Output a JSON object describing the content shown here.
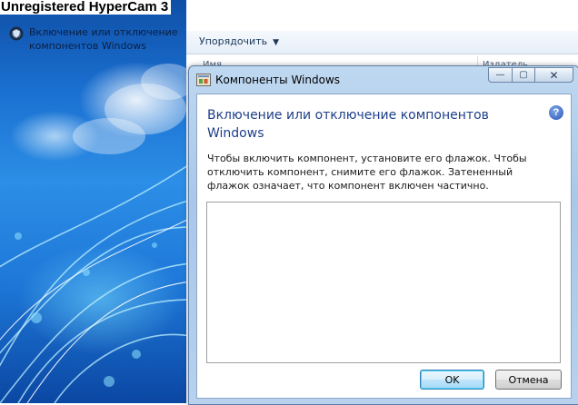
{
  "watermark": "Unregistered HyperCam 3",
  "sidebar": {
    "link_icon": "shield-icon",
    "link_text": "Включение или отключение компонентов Windows"
  },
  "toolbar": {
    "organize_label": "Упорядочить",
    "organize_caret": "▼"
  },
  "list_header": {
    "col_name": "Имя",
    "col_publisher": "Издатель"
  },
  "dialog": {
    "title": "Компоненты Windows",
    "app_icon": "windows-features-icon",
    "caption": {
      "minimize": "—",
      "maximize": "▢",
      "close": "✕"
    },
    "heading": "Включение или отключение компонентов Windows",
    "help_icon_text": "?",
    "description": "Чтобы включить компонент, установите его флажок. Чтобы отключить компонент, снимите его флажок. Затененный флажок означает, что компонент включен частично.",
    "ok_label": "OK",
    "cancel_label": "Отмена"
  },
  "colors": {
    "accent_heading": "#1e3f8a",
    "dialog_frame": "#a9c7e8",
    "wallpaper": "#1a6fd0"
  }
}
